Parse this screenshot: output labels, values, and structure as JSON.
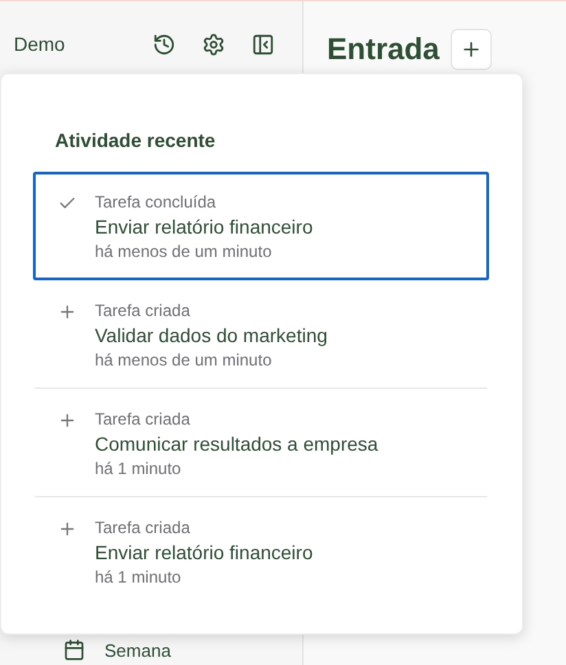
{
  "sidebar": {
    "workspace": "Demo",
    "items": [
      {
        "label": "Semana"
      }
    ]
  },
  "main": {
    "title": "Entrada"
  },
  "popover": {
    "title": "Atividade recente",
    "items": [
      {
        "kind": "completed",
        "selected": true,
        "action": "Tarefa concluída",
        "task": "Enviar relatório financeiro",
        "time": "há menos de um minuto"
      },
      {
        "kind": "created",
        "selected": false,
        "action": "Tarefa criada",
        "task": "Validar dados do marketing",
        "time": "há menos de um minuto"
      },
      {
        "kind": "created",
        "selected": false,
        "action": "Tarefa criada",
        "task": "Comunicar resultados a empresa",
        "time": "há 1 minuto"
      },
      {
        "kind": "created",
        "selected": false,
        "action": "Tarefa criada",
        "task": "Enviar relatório financeiro",
        "time": "há 1 minuto"
      }
    ]
  }
}
